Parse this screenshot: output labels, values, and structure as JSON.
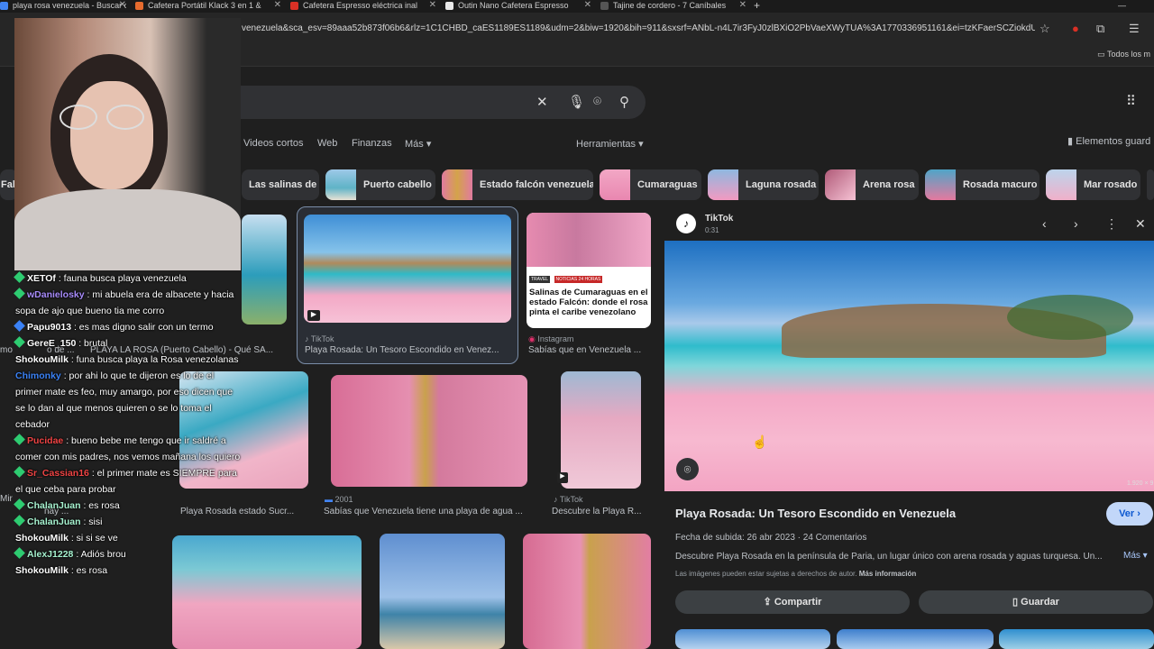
{
  "tabs": [
    {
      "label": "playa rosa venezuela - Buscar c",
      "color": "#4285f4"
    },
    {
      "label": "Cafetera Portátil Klack 3 en 1 &",
      "color": "#e66b2e"
    },
    {
      "label": "Cafetera Espresso eléctrica inal",
      "color": "#d93025"
    },
    {
      "label": "Outin Nano Cafetera Espresso",
      "color": "#eaeaea"
    },
    {
      "label": "Tajine de cordero - 7 Caníbales",
      "color": "#444444"
    }
  ],
  "new_tab": "+",
  "url": "venezuela&sca_esv=89aaa52b873f06b6&rlz=1C1CHBD_caES1189ES1189&udm=2&biw=1920&bih=911&sxsrf=ANbL-n4L7ir3FyJ0zlBXiO2PbVaeXWyTUA%3A1770336951161&ei=tzKFaerSCZiokdU...",
  "bookmarks_all": "Todos los m",
  "nav": {
    "videos": "Videos cortos",
    "web": "Web",
    "finanzas": "Finanzas",
    "mas": "Más ▾",
    "herramientas": "Herramientas ▾",
    "guardados": "Elementos guard"
  },
  "chips": [
    "Las salinas de",
    "Puerto cabello",
    "Estado falcón venezuela",
    "Cumaraguas",
    "Laguna rosada",
    "Arena rosa",
    "Rosada macuro",
    "Mar rosado"
  ],
  "left_chip": "Fal",
  "results": [
    {
      "source": "",
      "title": "PLAYA LA ROSA (Puerto Cabello) - Qué SA..."
    },
    {
      "source": "TikTok",
      "title": "Playa Rosada: Un Tesoro Escondido en Venez..."
    },
    {
      "source": "Instagram",
      "title": "Sabías que en Venezuela ..."
    },
    {
      "source": "",
      "title": "Playa Rosada estado Sucr..."
    },
    {
      "source": "2001",
      "title": "Sabías que Venezuela tiene una playa de agua ..."
    },
    {
      "source": "TikTok",
      "title": "Descubre la Playa R..."
    }
  ],
  "left_caps": {
    "a": "mosta",
    "b": "o de ...",
    "c": "Mira",
    "d": "hay ..."
  },
  "instagram_card": {
    "tag1": "TRAVEL",
    "tag2": "NOTICIAS 24 HORAS",
    "headline": "Salinas de Cumaraguas en el estado Falcón: donde el rosa pinta el caribe venezolano"
  },
  "panel": {
    "source": "TikTok",
    "duration": "0:31",
    "size": "1.920 × 9",
    "title": "Playa Rosada: Un Tesoro Escondido en Venezuela",
    "ver": "Ver ›",
    "date": "Fecha de subida: 26 abr 2023",
    "comments": "24 Comentarios",
    "desc": "Descubre Playa Rosada en la península de Paria, un lugar único con arena rosada y aguas turquesa. Un...",
    "mas": "Más ▾",
    "copyright": "Las imágenes pueden estar sujetas a derechos de autor.",
    "more_info": "Más información",
    "share": "Compartir",
    "save": "Guardar"
  },
  "chat": [
    {
      "user": "XETOf",
      "color": "#ffffff",
      "text": ": fauna busca playa venezuela"
    },
    {
      "user": "wDanielosky",
      "color": "#a78bfa",
      "text": ": mi abuela era de albacete y hacia sopa de ajo que bueno tia me corro"
    },
    {
      "user": "Papu9013",
      "color": "#ffffff",
      "text": ": es mas digno salir con un termo"
    },
    {
      "user": "GereE_150",
      "color": "#ffffff",
      "text": ": brutal"
    },
    {
      "user": "ShokouMilk",
      "color": "#ffffff",
      "text": ": funa busca playa la Rosa venezolanas"
    },
    {
      "user": "Chimonky",
      "color": "#3b82f6",
      "text": ": por ahi lo que te dijeron es lo de el primer mate es feo, muy amargo, por eso dicen que se lo dan al que menos quieren o se lo toma el cebador"
    },
    {
      "user": "Pucidae",
      "color": "#ef4444",
      "text": ": bueno bebe me tengo que ir saldré a comer con mis padres, nos vemos mañana los quiero"
    },
    {
      "user": "Sr_Cassian16",
      "color": "#ef4444",
      "text": ": el primer mate es SIEMPRE para el que ceba para probar"
    },
    {
      "user": "ChalanJuan",
      "color": "#a7f3d0",
      "text": ": es rosa"
    },
    {
      "user": "ChalanJuan",
      "color": "#a7f3d0",
      "text": ": sisi"
    },
    {
      "user": "ShokouMilk",
      "color": "#ffffff",
      "text": ": si si se ve"
    },
    {
      "user": "AlexJ1228",
      "color": "#a7f3d0",
      "text": ": Adiós brou"
    },
    {
      "user": "ShokouMilk",
      "color": "#ffffff",
      "text": ": es rosa"
    }
  ]
}
